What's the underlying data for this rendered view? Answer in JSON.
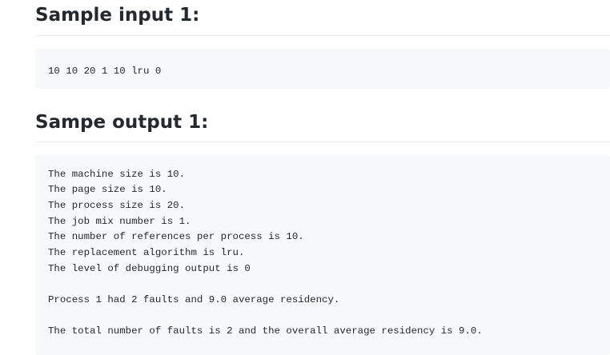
{
  "sections": [
    {
      "heading": "Sample input 1:",
      "code": "10 10 20 1 10 lru 0"
    },
    {
      "heading": "Sampe output 1:",
      "lines": [
        "The machine size is 10.",
        "The page size is 10.",
        "The process size is 20.",
        "The job mix number is 1.",
        "The number of references per process is 10.",
        "The replacement algorithm is lru.",
        "The level of debugging output is 0",
        "",
        "Process 1 had 2 faults and 9.0 average residency.",
        "",
        "The total number of faults is 2 and the overall average residency is 9.0."
      ]
    }
  ]
}
